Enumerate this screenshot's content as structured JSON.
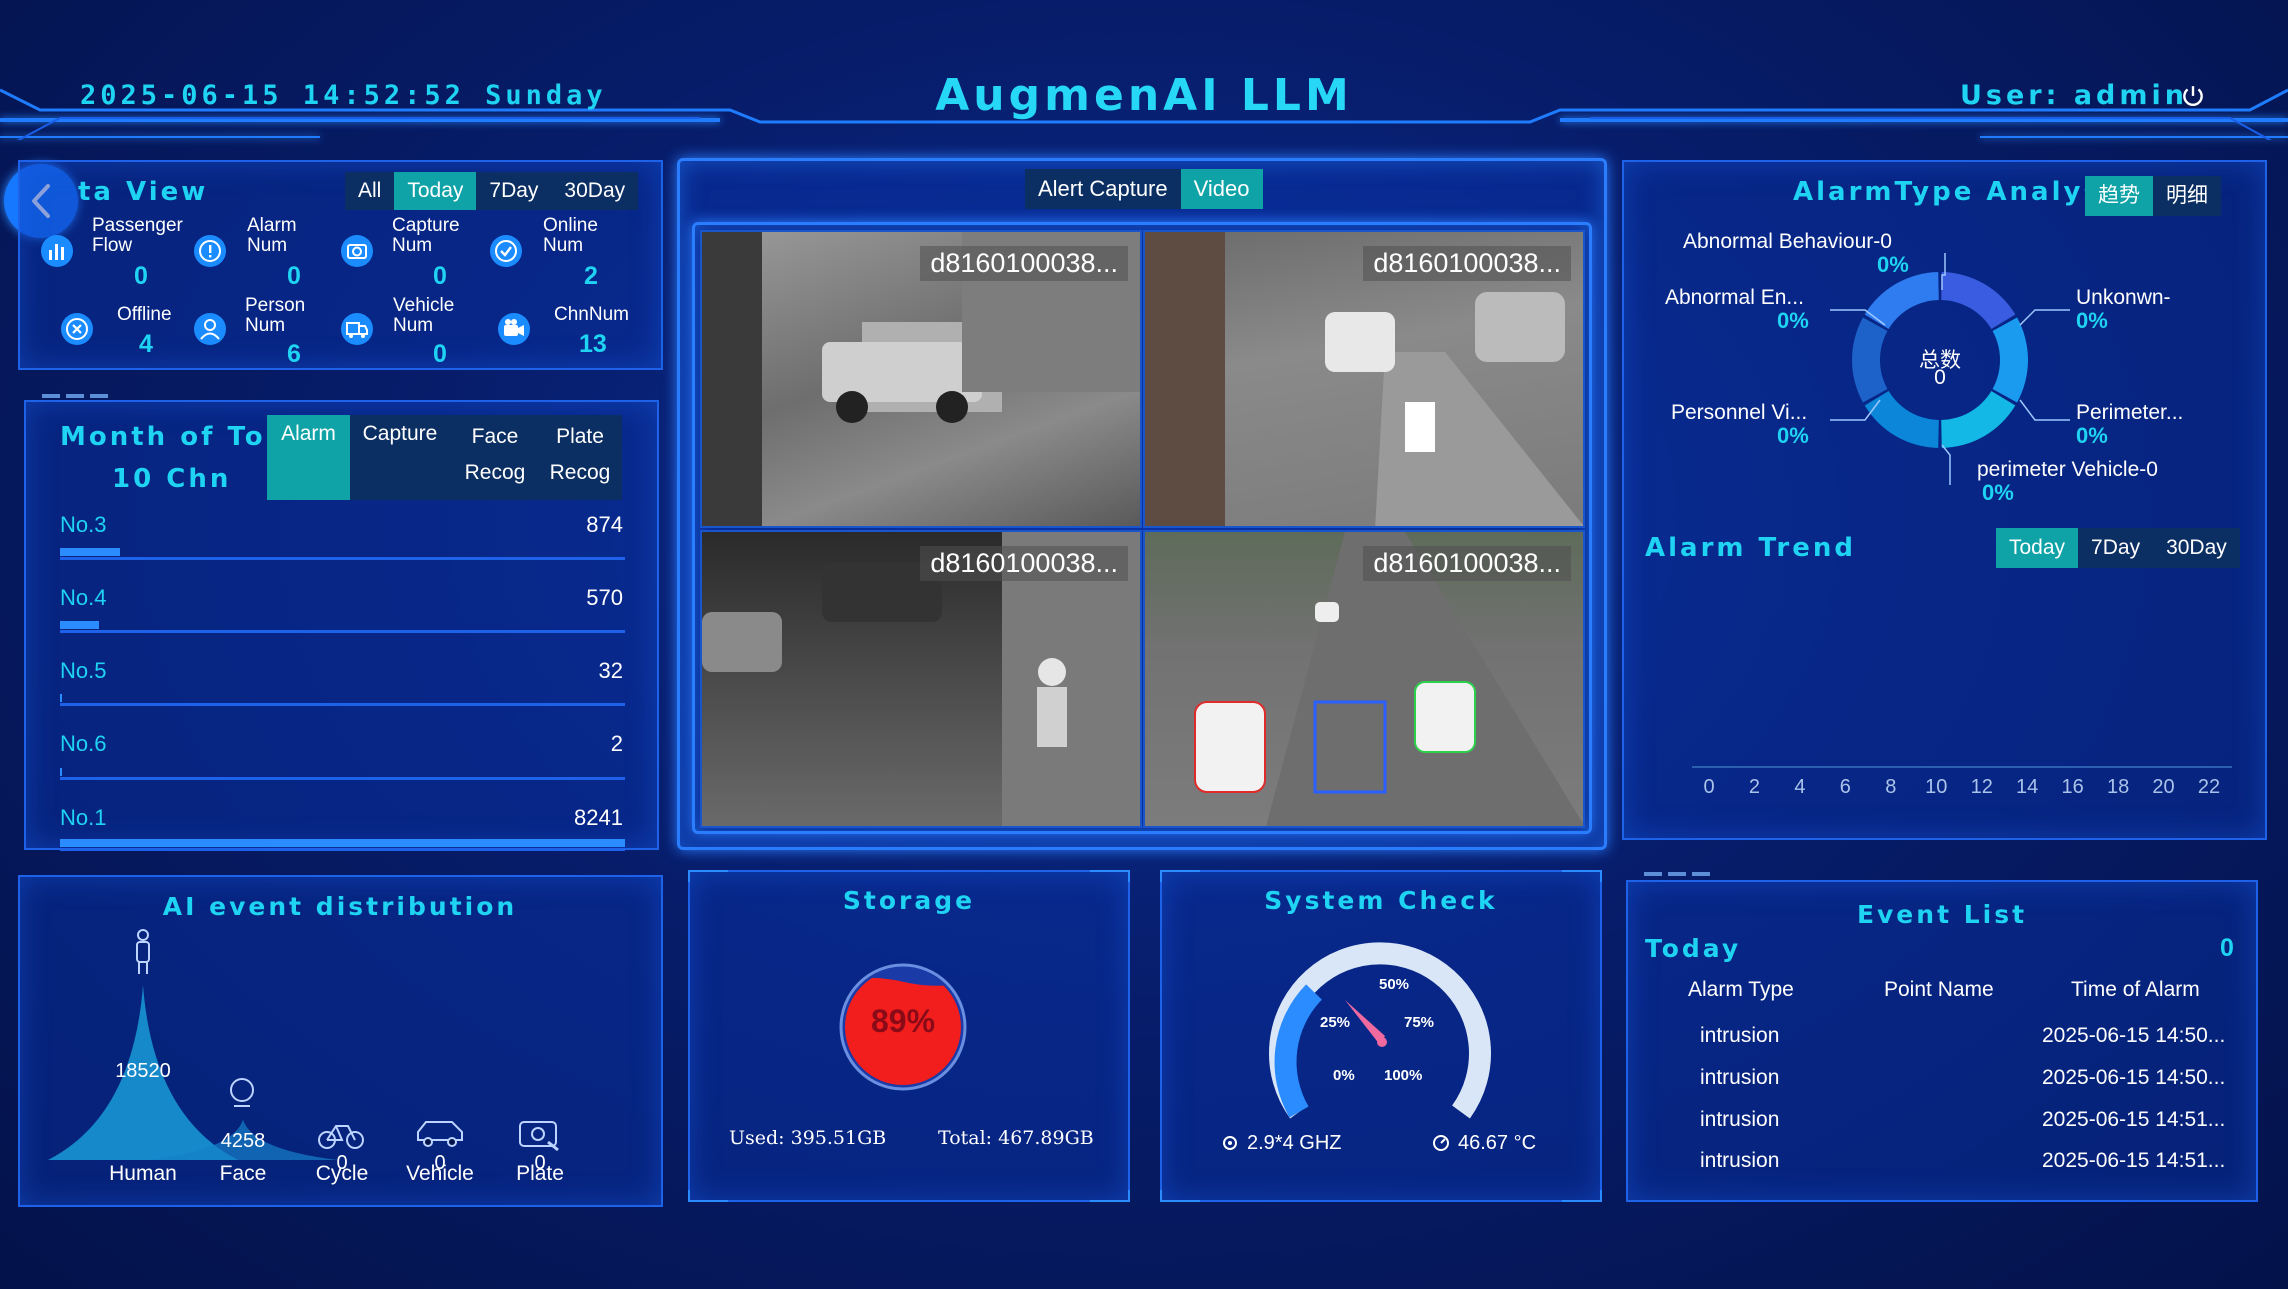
{
  "header": {
    "datetime": "2025-06-15 14:52:52 Sunday",
    "title": "AugmenAI LLM",
    "user": "User: admin"
  },
  "data_view": {
    "title": "ta View",
    "tabs": [
      "All",
      "Today",
      "7Day",
      "30Day"
    ],
    "active_tab": "Today",
    "stats": [
      {
        "label1": "Passenger",
        "label2": "Flow",
        "value": "0",
        "icon": "bar-chart-icon"
      },
      {
        "label1": "Alarm",
        "label2": "Num",
        "value": "0",
        "icon": "alert-icon"
      },
      {
        "label1": "Capture",
        "label2": "Num",
        "value": "0",
        "icon": "camera-icon"
      },
      {
        "label1": "Online",
        "label2": "Num",
        "value": "2",
        "icon": "check-icon"
      },
      {
        "label1": "Offline",
        "label2": "",
        "value": "4",
        "icon": "offline-icon"
      },
      {
        "label1": "Person",
        "label2": "Num",
        "value": "6",
        "icon": "person-icon"
      },
      {
        "label1": "Vehicle",
        "label2": "Num",
        "value": "0",
        "icon": "truck-icon"
      },
      {
        "label1": "ChnNum",
        "label2": "",
        "value": "13",
        "icon": "video-icon"
      }
    ]
  },
  "top_chn": {
    "title_line1": "Month of Top",
    "title_line2": "10 Chn",
    "tabs": [
      {
        "line1": "Alarm",
        "line2": ""
      },
      {
        "line1": "Capture",
        "line2": ""
      },
      {
        "line1": "Face",
        "line2": "Recog"
      },
      {
        "line1": "Plate",
        "line2": "Recog"
      }
    ],
    "active_tab": "Alarm",
    "ranks": [
      {
        "label": "No.3",
        "value": 874
      },
      {
        "label": "No.4",
        "value": 570
      },
      {
        "label": "No.5",
        "value": 32
      },
      {
        "label": "No.6",
        "value": 2
      },
      {
        "label": "No.1",
        "value": 8241
      }
    ]
  },
  "video": {
    "tabs": [
      "Alert Capture",
      "Video"
    ],
    "active_tab": "Video",
    "cams": [
      "d8160100038...",
      "d8160100038...",
      "d8160100038...",
      "d8160100038..."
    ]
  },
  "alarm_type": {
    "title": "AlarmType Analysis",
    "tabs": [
      "趋势",
      "明细"
    ],
    "active_tab": "趋势",
    "center_label": "总数",
    "center_value": "0",
    "legend": [
      {
        "name": "Abnormal Behaviour-0",
        "pct": "0%"
      },
      {
        "name": "Abnormal En...",
        "pct": "0%"
      },
      {
        "name": "Unkonwn-",
        "pct": "0%"
      },
      {
        "name": "Personnel Vi...",
        "pct": "0%"
      },
      {
        "name": "Perimeter...",
        "pct": "0%"
      },
      {
        "name": "perimeter Vehicle-0",
        "pct": "0%"
      }
    ],
    "colors": [
      "#3a5ce0",
      "#1a9bf0",
      "#13b8e6",
      "#0b86d8",
      "#1d62c8",
      "#2f7cf0"
    ]
  },
  "alarm_trend": {
    "title": "Alarm Trend",
    "tabs": [
      "Today",
      "7Day",
      "30Day"
    ],
    "active_tab": "Today",
    "chart_data": {
      "type": "line",
      "x": [
        0,
        2,
        4,
        6,
        8,
        10,
        12,
        14,
        16,
        18,
        20,
        22
      ],
      "series": []
    }
  },
  "ai_event": {
    "title": "AI event distribution",
    "chart_data": {
      "type": "area",
      "categories": [
        "Human",
        "Face",
        "Cycle",
        "Vehicle",
        "Plate"
      ],
      "values": [
        18520,
        4258,
        0,
        0,
        0
      ]
    },
    "icons": [
      "person-icon",
      "face-icon",
      "bicycle-icon",
      "car-icon",
      "plate-camera-icon"
    ]
  },
  "storage": {
    "title": "Storage",
    "percent": "89%",
    "percent_value": 89,
    "used_label": "Used:",
    "used": "395.51GB",
    "total_label": "Total:",
    "total": "467.89GB"
  },
  "system_check": {
    "title": "System Check",
    "ticks": [
      "0%",
      "25%",
      "50%",
      "75%",
      "100%"
    ],
    "cpu": "2.9*4 GHZ",
    "temp": "46.67 °C"
  },
  "event_list": {
    "title": "Event List",
    "period": "Today",
    "count": "0",
    "columns": [
      "Alarm Type",
      "Point Name",
      "Time of Alarm"
    ],
    "rows": [
      {
        "type": "intrusion",
        "point": "",
        "time": "2025-06-15 14:50..."
      },
      {
        "type": "intrusion",
        "point": "",
        "time": "2025-06-15 14:50..."
      },
      {
        "type": "intrusion",
        "point": "",
        "time": "2025-06-15 14:51..."
      },
      {
        "type": "intrusion",
        "point": "",
        "time": "2025-06-15 14:51..."
      }
    ]
  }
}
